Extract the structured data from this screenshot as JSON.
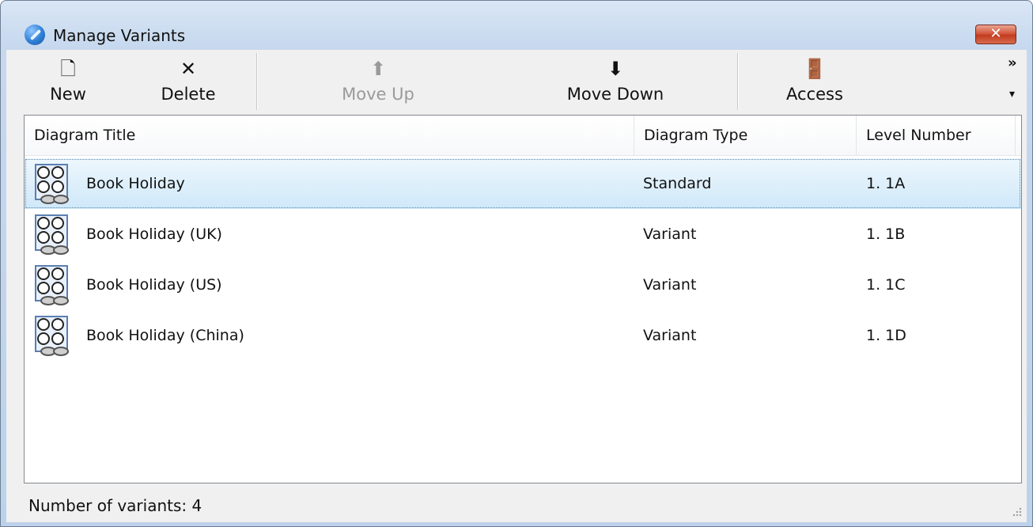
{
  "window": {
    "title": "Manage Variants",
    "close_glyph": "✕"
  },
  "toolbar": {
    "buttons": [
      {
        "label": "New",
        "icon": "new-document-icon",
        "glyph": "🗋",
        "enabled": true
      },
      {
        "label": "Delete",
        "icon": "delete-x-icon",
        "glyph": "✕",
        "enabled": true
      },
      {
        "label": "Move Up",
        "icon": "arrow-up-icon",
        "glyph": "⬆",
        "enabled": false
      },
      {
        "label": "Move Down",
        "icon": "arrow-down-icon",
        "glyph": "⬇",
        "enabled": true
      },
      {
        "label": "Access",
        "icon": "door-exit-icon",
        "glyph": "🚪",
        "enabled": true
      }
    ],
    "overflow_glyph": "»",
    "dropdown_glyph": "▾"
  },
  "list": {
    "columns": [
      "Diagram Title",
      "Diagram Type",
      "Level Number"
    ],
    "rows": [
      {
        "title": "Book Holiday",
        "type": "Standard",
        "level": "1. 1A",
        "selected": true
      },
      {
        "title": "Book Holiday (UK)",
        "type": "Variant",
        "level": "1. 1B",
        "selected": false
      },
      {
        "title": "Book Holiday (US)",
        "type": "Variant",
        "level": "1. 1C",
        "selected": false
      },
      {
        "title": "Book Holiday (China)",
        "type": "Variant",
        "level": "1. 1D",
        "selected": false
      }
    ]
  },
  "status": {
    "text": "Number of variants: 4"
  },
  "colors": {
    "selection": "#cfe8f9",
    "title_gradient": "#c6d8ee",
    "close_red": "#c23b20"
  }
}
